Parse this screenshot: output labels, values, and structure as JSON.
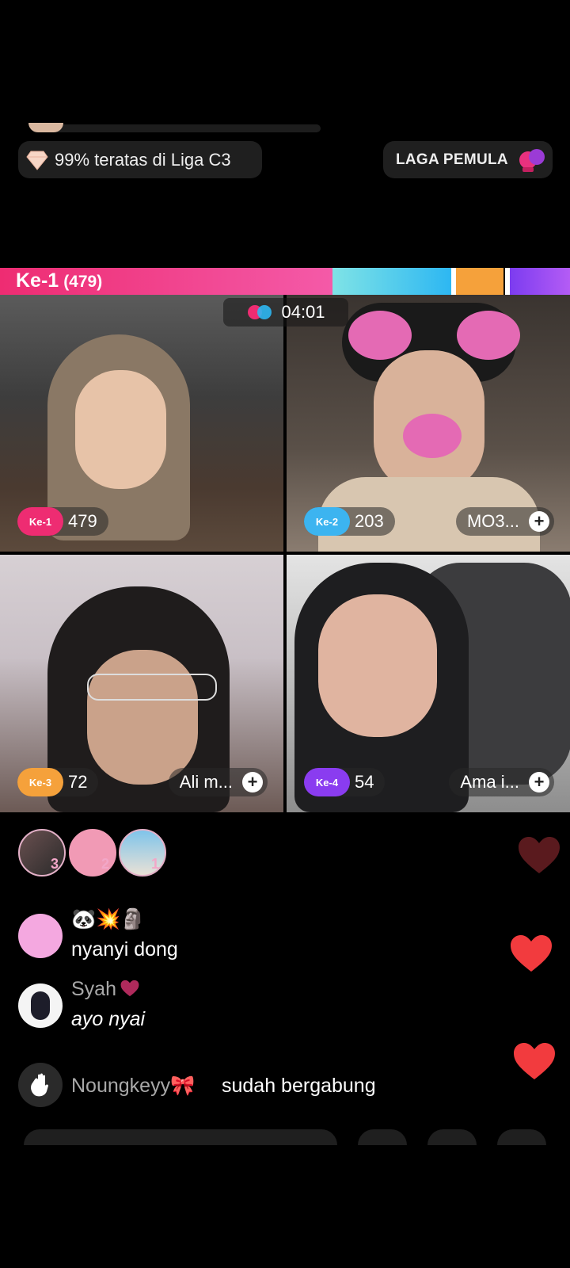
{
  "league": {
    "text": "99% teratas di Liga C3",
    "icon": "diamond-icon"
  },
  "laga": {
    "text": "LAGA PEMULA",
    "icon": "gloves-icon"
  },
  "score_bar": {
    "rank": "Ke-1",
    "score": "(479)"
  },
  "timer": {
    "value": "04:01",
    "icon": "battle-icon"
  },
  "tiles": [
    {
      "rank": "Ke-1",
      "score": "479",
      "name": "",
      "color": "#ee2c72"
    },
    {
      "rank": "Ke-2",
      "score": "203",
      "name": "MO3...",
      "color": "#3cb4f0"
    },
    {
      "rank": "Ke-3",
      "score": "72",
      "name": "Ali m...",
      "color": "#f5a13b"
    },
    {
      "rank": "Ke-4",
      "score": "54",
      "name": "Ama i...",
      "color": "#8a3cf0"
    }
  ],
  "viewers": [
    {
      "rank": "3"
    },
    {
      "rank": "2"
    },
    {
      "rank": "1"
    }
  ],
  "comments": [
    {
      "name": "🐼💥🗿",
      "text": "nyanyi dong"
    },
    {
      "name": "Syah",
      "text": "ayo nyai"
    }
  ],
  "join": {
    "name": "Noungkeyy🎀",
    "text": "sudah bergabung"
  }
}
